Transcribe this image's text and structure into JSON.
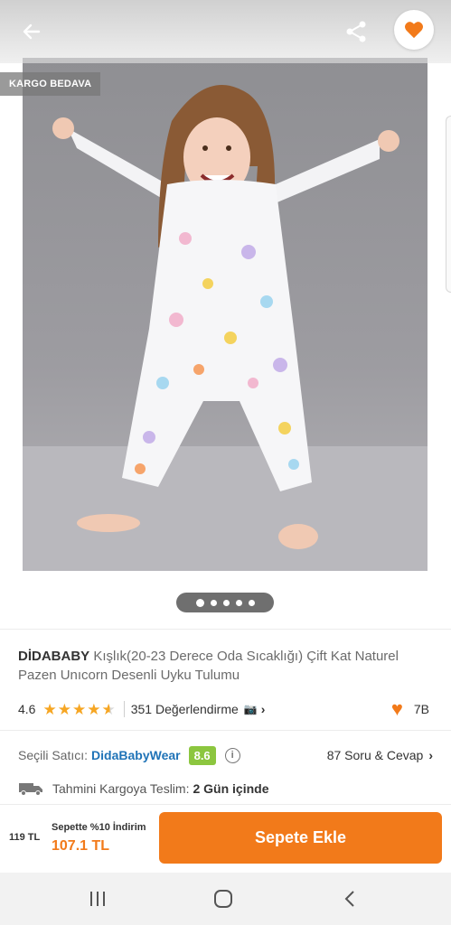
{
  "header": {
    "back_icon": "arrow-left-icon",
    "share_icon": "share-icon",
    "favorite_icon": "heart-icon"
  },
  "gallery": {
    "badge": "KARGO BEDAVA",
    "image_description_icon": "product-photo",
    "page_count": 5,
    "active_page": 1
  },
  "product": {
    "brand": "DİDABABY",
    "name": " Kışlık(20-23 Derece Oda Sıcaklığı) Çift Kat Naturel Pazen Unıcorn Desenli Uyku Tulumu",
    "rating": "4.6",
    "reviews": "351 Değerlendirme",
    "review_camera_icon": "📷",
    "likes": "7B"
  },
  "seller": {
    "label": "Seçili Satıcı:",
    "name": "DidaBabyWear",
    "score": "8.6",
    "qa": "87 Soru & Cevap"
  },
  "delivery": {
    "label": "Tahmini Kargoya Teslim:",
    "days": "2 Gün içinde"
  },
  "purchase": {
    "old_price": "119 TL",
    "discount": "Sepette %10 İndirim",
    "new_price": "107.1 TL",
    "add_to_cart": "Sepete Ekle"
  },
  "colors": {
    "accent": "#f27a1a",
    "star": "#f6a623",
    "seller_link": "#1f73b7",
    "score_badge": "#8cc63f"
  }
}
